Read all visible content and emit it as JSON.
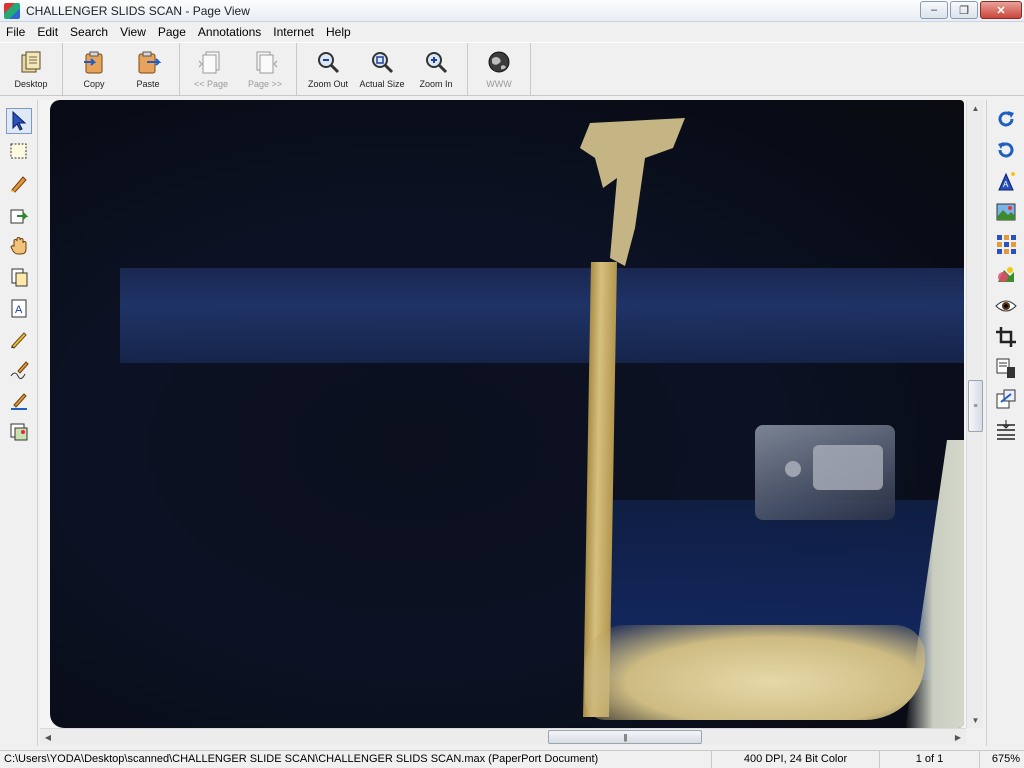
{
  "window": {
    "title": "CHALLENGER SLIDS SCAN - Page View",
    "controls": {
      "minimize": "–",
      "maximize": "❐",
      "close": "✕"
    }
  },
  "menu": [
    "File",
    "Edit",
    "Search",
    "View",
    "Page",
    "Annotations",
    "Internet",
    "Help"
  ],
  "toolbar": {
    "desktop": "Desktop",
    "copy": "Copy",
    "paste": "Paste",
    "prev_page": "<< Page",
    "next_page": "Page >>",
    "zoom_out": "Zoom Out",
    "actual_size": "Actual Size",
    "zoom_in": "Zoom In",
    "www": "WWW"
  },
  "left_tools": [
    "select-arrow-icon",
    "marquee-select-icon",
    "highlighter-icon",
    "send-to-icon",
    "hand-pan-icon",
    "copy-page-icon",
    "text-recognize-icon",
    "pencil-icon",
    "freehand-draw-icon",
    "line-draw-icon",
    "image-stamp-icon"
  ],
  "right_tools": [
    "rotate-clockwise-icon",
    "rotate-counterclockwise-icon",
    "enhance-wand-icon",
    "photo-edit-icon",
    "thumbnail-grid-icon",
    "color-adjust-icon",
    "eye-icon",
    "crop-icon",
    "clipboard-icon",
    "export-icon",
    "straighten-icon"
  ],
  "status": {
    "path": "C:\\Users\\YODA\\Desktop\\scanned\\CHALLENGER SLIDE SCAN\\CHALLENGER SLIDS SCAN.max (PaperPort Document)",
    "resolution": "400 DPI, 24 Bit Color",
    "page": "1 of 1",
    "zoom": "675%"
  },
  "scrollbar": {
    "grip": "|||",
    "grip_vertical": "≡"
  },
  "colors": {
    "accent": "#3c6fb4",
    "titlebar": "#e8eef5"
  }
}
